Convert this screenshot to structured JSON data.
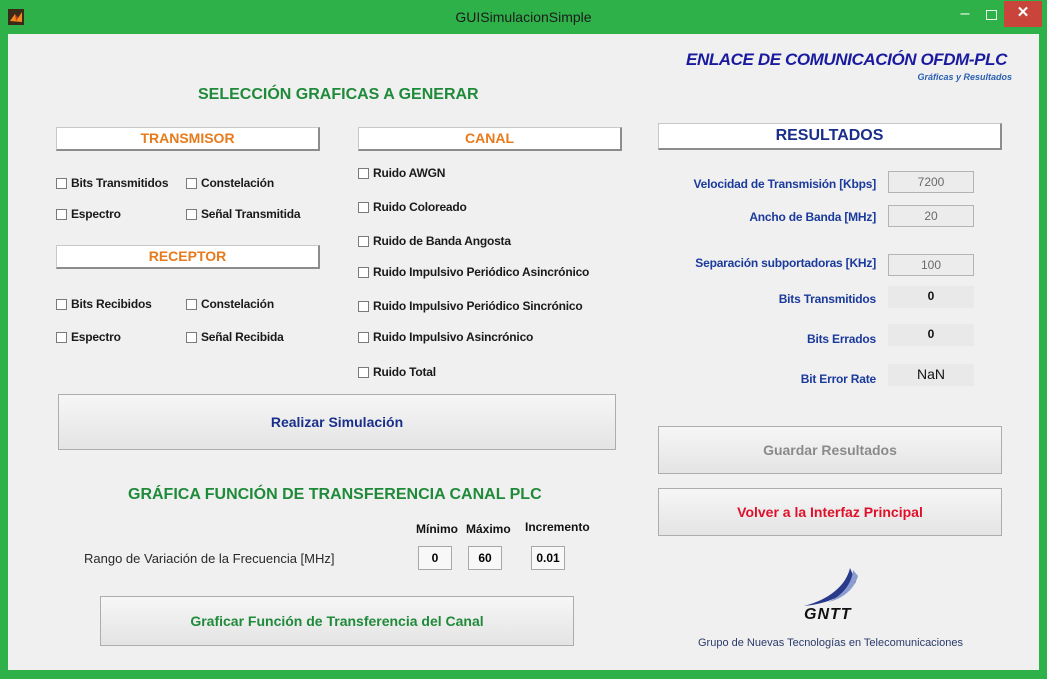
{
  "window": {
    "title": "GUISimulacionSimple",
    "minimize": "‒",
    "close": "✕"
  },
  "brand": {
    "title": "ENLACE DE COMUNICACIÓN OFDM-PLC",
    "subtitle": "Gráficas y Resultados"
  },
  "selection": {
    "heading": "SELECCIÓN GRAFICAS A GENERAR",
    "transmisor": {
      "title": "TRANSMISOR",
      "options": [
        "Bits Transmitidos",
        "Constelación",
        "Espectro",
        "Señal Transmitida"
      ]
    },
    "receptor": {
      "title": "RECEPTOR",
      "options": [
        "Bits Recibidos",
        "Constelación",
        "Espectro",
        "Señal Recibida"
      ]
    },
    "canal": {
      "title": "CANAL",
      "options": [
        "Ruido AWGN",
        "Ruido Coloreado",
        "Ruido de Banda Angosta",
        "Ruido Impulsivo Periódico Asincrónico",
        "Ruido Impulsivo Periódico Sincrónico",
        "Ruido Impulsivo Asincrónico",
        "Ruido Total"
      ]
    },
    "simulate_button": "Realizar Simulación"
  },
  "transfer": {
    "heading": "GRÁFICA FUNCIÓN DE TRANSFERENCIA CANAL PLC",
    "range_label": "Rango de Variación de la Frecuencia [MHz]",
    "headers": [
      "Mínimo",
      "Máximo",
      "Incremento"
    ],
    "values": [
      "0",
      "60",
      "0.01"
    ],
    "plot_button": "Graficar Función de Transferencia del Canal"
  },
  "results": {
    "title": "RESULTADOS",
    "rows": [
      {
        "label": "Velocidad de Transmisión [Kbps]",
        "value": "7200"
      },
      {
        "label": "Ancho de Banda [MHz]",
        "value": "20"
      },
      {
        "label": "Separación subportadoras [KHz]",
        "value": "100"
      },
      {
        "label": "Bits Transmitidos",
        "value": "0"
      },
      {
        "label": "Bits Errados",
        "value": "0"
      },
      {
        "label": "Bit Error Rate",
        "value": "NaN"
      }
    ],
    "save_button": "Guardar Resultados",
    "back_button": "Volver a la Interfaz Principal"
  },
  "logo": {
    "text": "GNTT",
    "caption": "Grupo de Nuevas Tecnologías en Telecomunicaciones"
  },
  "colors": {
    "frame": "#2fb14a",
    "heading_green": "#1f8a3a",
    "orange": "#e87a1c",
    "navy": "#1a2f8c",
    "red": "#e0102a",
    "close": "#c9443a"
  }
}
